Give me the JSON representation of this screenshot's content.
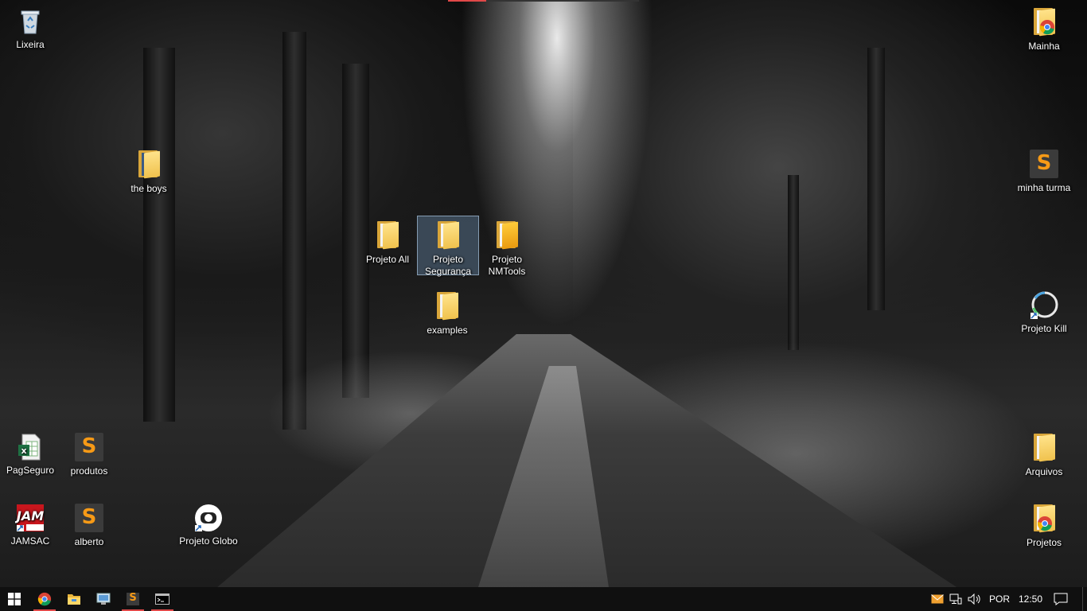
{
  "desktop": {
    "icons": [
      {
        "label": "Lixeira"
      },
      {
        "label": "the boys"
      },
      {
        "label": "Projeto All"
      },
      {
        "label": "Projeto Segurança"
      },
      {
        "label": "Projeto NMTools"
      },
      {
        "label": "examples"
      },
      {
        "label": "PagSeguro"
      },
      {
        "label": "produtos"
      },
      {
        "label": "JAMSAC"
      },
      {
        "label": "alberto"
      },
      {
        "label": "Projeto Globo"
      },
      {
        "label": "Mainha"
      },
      {
        "label": "minha turma"
      },
      {
        "label": "Projeto Kill"
      },
      {
        "label": "Arquivos"
      },
      {
        "label": "Projetos"
      }
    ]
  },
  "taskbar": {
    "language": "POR",
    "time": "12:50"
  },
  "colors": {
    "taskbar": "#101010",
    "selection": "#78a0c8",
    "active_indicator": "#e04848"
  }
}
